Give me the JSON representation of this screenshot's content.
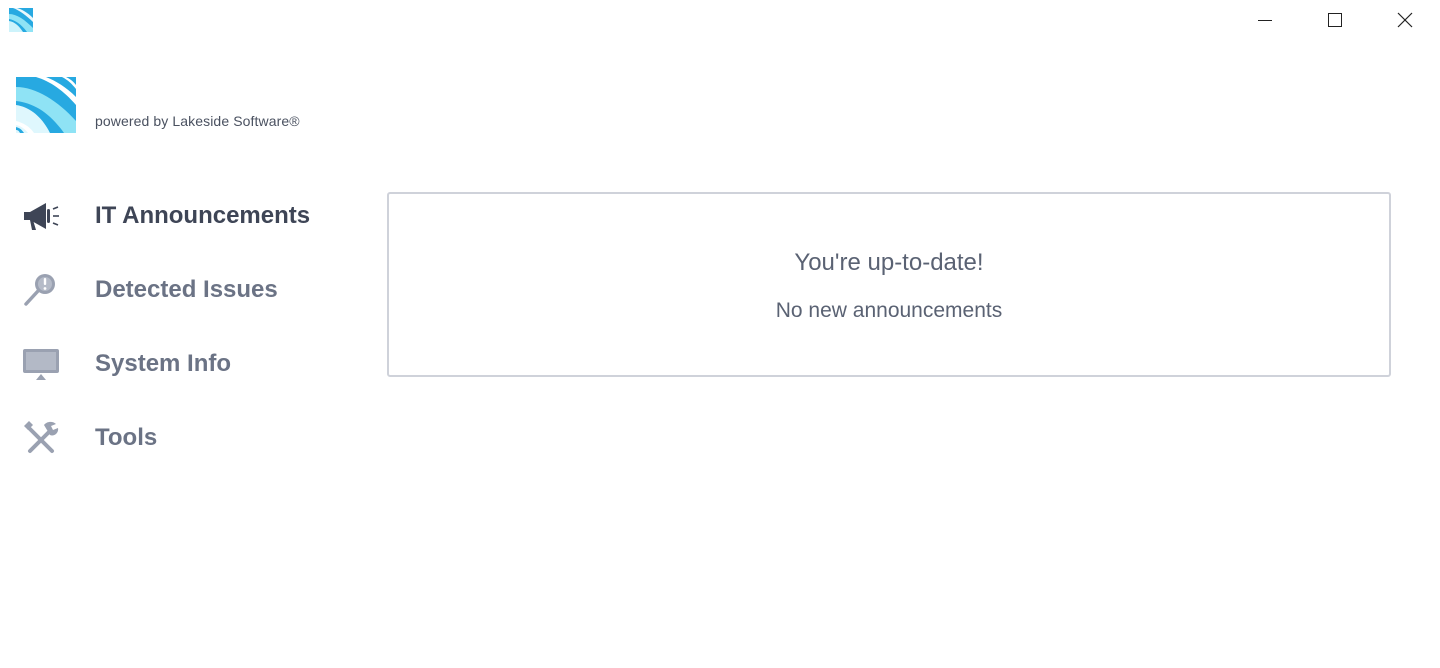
{
  "window": {
    "controls": {
      "minimize": "minimize-icon",
      "maximize": "maximize-icon",
      "close": "close-icon"
    }
  },
  "brand": {
    "powered_by": "powered by Lakeside Software®",
    "logo_colors": [
      "#27a9e1",
      "#8fe3f5",
      "#e9f8fd"
    ]
  },
  "sidebar": {
    "items": [
      {
        "label": "IT Announcements",
        "icon": "megaphone-icon",
        "active": true
      },
      {
        "label": "Detected Issues",
        "icon": "magnifier-alert-icon",
        "active": false
      },
      {
        "label": "System Info",
        "icon": "monitor-icon",
        "active": false
      },
      {
        "label": "Tools",
        "icon": "tools-icon",
        "active": false
      }
    ]
  },
  "main": {
    "status_title": "You're up-to-date!",
    "status_subtitle": "No new announcements"
  },
  "colors": {
    "active_text": "#3e4556",
    "inactive_text": "#6b7385",
    "icon_active": "#3e4556",
    "icon_inactive": "#9aa1b1",
    "card_border": "#cfd2da"
  }
}
